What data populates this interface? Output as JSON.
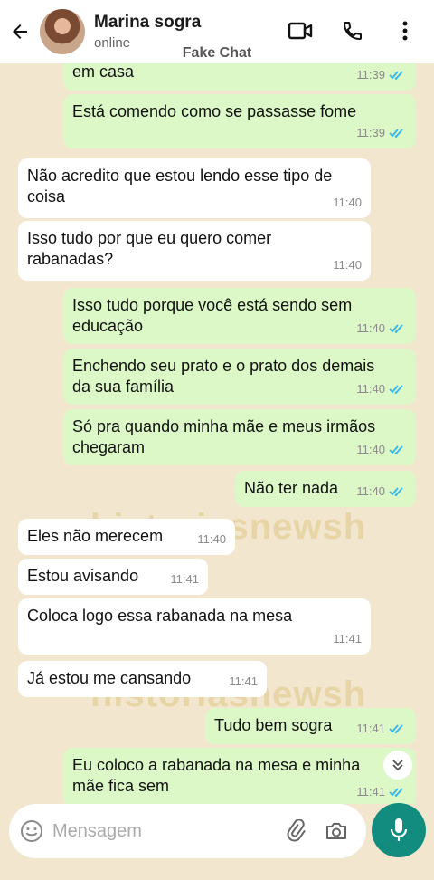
{
  "header": {
    "contact_name": "Marina sogra",
    "status": "online",
    "watermark_label": "Fake Chat"
  },
  "watermarks": [
    "historiasnewsh",
    "historiasnewsh"
  ],
  "messages": [
    {
      "side": "out",
      "text": "em casa",
      "time": "11:39"
    },
    {
      "side": "out",
      "text": "Está comendo como se passasse fome",
      "time": "11:39"
    },
    {
      "side": "in",
      "text": "Não acredito que estou lendo esse tipo de coisa",
      "time": "11:40"
    },
    {
      "side": "in",
      "text": "Isso tudo por que eu quero comer rabanadas?",
      "time": "11:40"
    },
    {
      "side": "out",
      "text": "Isso tudo porque você está sendo sem educação",
      "time": "11:40"
    },
    {
      "side": "out",
      "text": "Enchendo seu prato e o prato dos demais da sua família",
      "time": "11:40"
    },
    {
      "side": "out",
      "text": "Só pra quando minha mãe e meus irmãos chegaram",
      "time": "11:40"
    },
    {
      "side": "out",
      "text": "Não ter nada",
      "time": "11:40"
    },
    {
      "side": "in",
      "text": "Eles não merecem",
      "time": "11:40"
    },
    {
      "side": "in",
      "text": "Estou avisando",
      "time": "11:41"
    },
    {
      "side": "in",
      "text": "Coloca logo essa rabanada na mesa",
      "time": "11:41"
    },
    {
      "side": "in",
      "text": "Já estou me cansando",
      "time": "11:41"
    },
    {
      "side": "out",
      "text": "Tudo bem sogra",
      "time": "11:41"
    },
    {
      "side": "out",
      "text": "Eu coloco a rabanada na mesa e minha mãe fica sem",
      "time": "11:41"
    }
  ],
  "input": {
    "placeholder": "Mensagem"
  },
  "icons": {
    "back": "back-arrow-icon",
    "video": "video-call-icon",
    "phone": "phone-icon",
    "menu": "more-vertical-icon",
    "emoji": "emoji-icon",
    "attach": "paperclip-icon",
    "camera": "camera-icon",
    "mic": "microphone-icon",
    "scroll": "double-chevron-down-icon"
  },
  "colors": {
    "accent": "#128c7e",
    "outgoing_bubble": "#dcf8c6",
    "incoming_bubble": "#ffffff",
    "tick_blue": "#34b7f1",
    "background": "#f3e6cf"
  }
}
